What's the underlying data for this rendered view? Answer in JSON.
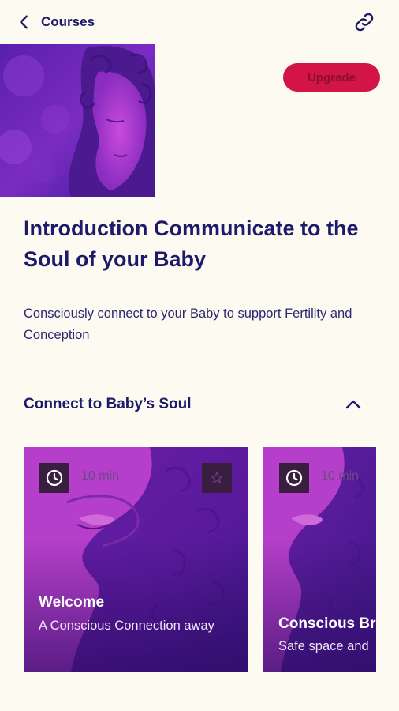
{
  "header": {
    "back_label": "Courses",
    "back_icon": "chevron-left-icon",
    "link_icon": "link-icon"
  },
  "upgrade_label": "Upgrade",
  "course": {
    "title": "Introduction Communicate to the Soul of your Baby",
    "description": "Consciously connect to your Baby to support Fertility and Conception"
  },
  "section": {
    "title": "Connect to Baby’s Soul",
    "toggle_icon": "chevron-up-icon",
    "expanded": true
  },
  "lessons": [
    {
      "duration": "10 min",
      "title": "Welcome",
      "subtitle": "A Conscious Connection away",
      "favorite_icon": "star-icon"
    },
    {
      "duration": "10 min",
      "title": "Conscious Br",
      "subtitle": "Safe space and"
    }
  ],
  "colors": {
    "background": "#fdfbf1",
    "primary_text": "#1d1a6b",
    "accent": "#d21546",
    "image_tint": "#6a1fa8"
  }
}
